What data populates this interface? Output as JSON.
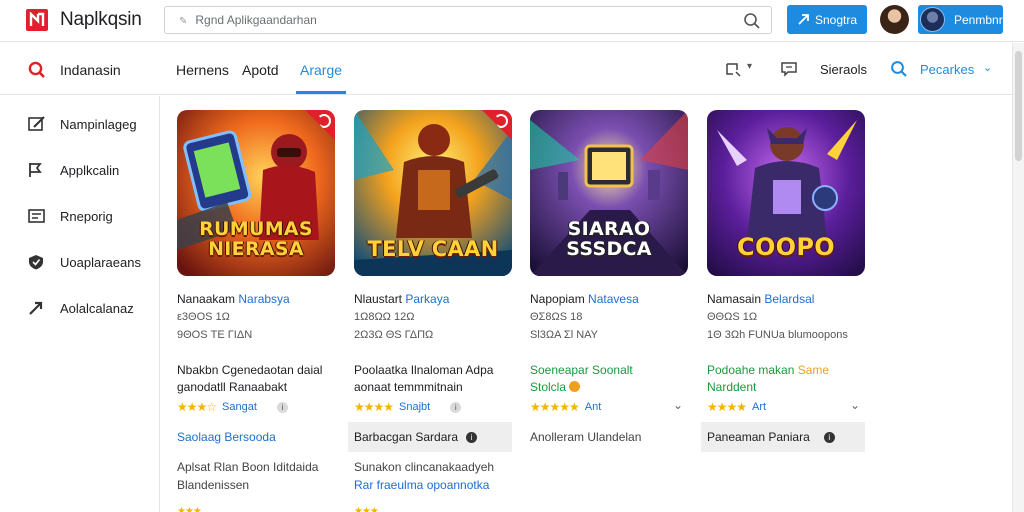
{
  "header": {
    "app_title": "Naplkqsin",
    "search_placeholder": "Rgnd Aplikgaandarhan",
    "button_label": "Snogtra",
    "profile_label": "Penmbnr"
  },
  "subnav": {
    "section_label": "Indanasin",
    "tabs": [
      {
        "label": "Hernens"
      },
      {
        "label": "Apotd"
      },
      {
        "label": "Ararge",
        "active": true
      }
    ],
    "right_label": "Sieraols",
    "right_dropdown": "Pecarkes"
  },
  "sidebar": {
    "items": [
      {
        "label": "Nampinlageg",
        "icon": "edit-icon"
      },
      {
        "label": "Applkcalin",
        "icon": "flag-icon"
      },
      {
        "label": "Rneporig",
        "icon": "list-box-icon"
      },
      {
        "label": "Uoaplaraeans",
        "icon": "shield-icon"
      },
      {
        "label": "Aolalcalanaz",
        "icon": "share-arrow-icon"
      }
    ]
  },
  "cards": [
    {
      "thumb_title": "RUMUMAS NIERASA",
      "name_a": "Nanaakam",
      "name_b": "Narabsya",
      "meta_1": "ε3ΘOS 1Ω",
      "meta_2": "9ΘOS ΤΕ ΓΙΔΝ",
      "desc": "Nbakbn Cgenedaotan daial ganodatll Ranaabakt",
      "rating_label": "Sangat",
      "action": "Saolaag Bersooda",
      "extra_line_1": "Aplsat Rlan Boon Iditdaida",
      "extra_line_2": "Blandenissen"
    },
    {
      "thumb_title": "TELV CAAN",
      "name_a": "Nlaustart",
      "name_b": "Parkaya",
      "meta_1": "1Ω8ΩΩ 12Ω",
      "meta_2": "2Ω3Ω ΘS ΓΔΠΩ",
      "desc": "Poolaatka Ilnaloman Adpa aonaat temmmitnain",
      "rating_label": "Snajbt",
      "action": "Barbacgan Sardara",
      "extra_line_1": "Sunakon clincanakaadyeh",
      "extra_line_2": "Rar fraeulma opoannotka"
    },
    {
      "thumb_title": "SIARAO SSSDCA",
      "name_a": "Napopiam",
      "name_b": "Natavesa",
      "meta_1": "ΘΣ8ΩS 18",
      "meta_2": "Sl3ΩA Σl ΝΑΥ",
      "desc_a": "Soeneapar Soonalt",
      "desc_b": "Stolcla",
      "rating_label": "Ant",
      "action": "Anolleram Ulandelan"
    },
    {
      "thumb_title": "COOPO",
      "name_a": "Namasain",
      "name_b": "Belardsal",
      "meta_1": "ΘΘΩS 1Ω",
      "meta_2": "1Θ 3Ωh FUNUa blumoopons",
      "desc_a": "Podoahe makan",
      "desc_b": "Same",
      "desc_c": "Narddent",
      "rating_label": "Art",
      "action": "Paneaman Paniara"
    }
  ],
  "colors": {
    "accent": "#1d8ce0",
    "brand_red": "#e0202a",
    "star": "#f4b400",
    "link": "#1d6fd1",
    "green": "#1a9a3f"
  }
}
